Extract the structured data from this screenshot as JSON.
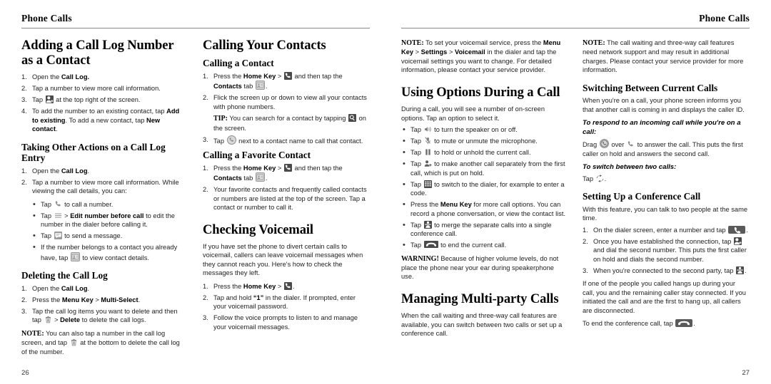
{
  "document": {
    "running_head_left": "Phone Calls",
    "running_head_right": "Phone Calls",
    "folio_left": "26",
    "folio_right": "27"
  },
  "left_page": {
    "column1": {
      "heading_adding": "Adding a Call Log Number as a Contact",
      "adding_steps": [
        "Open the Call Log.",
        "Tap a number to view more call information.",
        "Tap  at the top right of the screen.",
        "To add the number to an existing contact, tap Add to existing. To add a new contact, tap New contact."
      ],
      "heading_other_actions": "Taking Other Actions on a Call Log Entry",
      "other_steps": [
        "Open the Call Log.",
        "Tap a number to view more call information. While viewing the call details, you can:"
      ],
      "other_bullets": [
        "Tap  to call a number.",
        "Tap  > Edit number before call to edit the number in the dialer before calling it.",
        "Tap  to send a message.",
        "If the number belongs to a contact you already have, tap  to view contact details."
      ],
      "heading_deleting": "Deleting the Call Log",
      "deleting_steps": [
        "Open the Call Log.",
        "Press the Menu Key > Multi-Select.",
        "Tap the call log items you want to delete and then tap  > Delete to delete the call logs."
      ],
      "note_label": "NOTE:",
      "note_text": "You can also tap a number in the call log screen, and tap  at the bottom to delete the call log of the number."
    },
    "column2": {
      "heading_calling_contacts": "Calling Your Contacts",
      "heading_calling_contact": "Calling a Contact",
      "contact_steps": [
        "Press the Home Key >  and then tap the Contacts tab .",
        "Flick the screen up or down to view all your contacts with phone numbers.",
        "Tap  next to a contact name to call that contact."
      ],
      "tip_label": "TIP:",
      "tip_text": "You can search for a contact by tapping  on the screen.",
      "heading_favorite": "Calling a Favorite Contact",
      "favorite_steps": [
        "Press the Home Key >  and then tap the Contacts tab .",
        "Your favorite contacts and frequently called contacts or numbers are listed at the top of the screen. Tap a contact or number to call it."
      ],
      "heading_voicemail": "Checking Voicemail",
      "voicemail_intro": "If you have set the phone to divert certain calls to voicemail, callers can leave voicemail messages when they cannot reach you. Here's how to check the messages they left.",
      "voicemail_steps": [
        "Press the Home Key > .",
        "Tap and hold “1” in the dialer. If prompted, enter your voicemail password.",
        "Follow the voice prompts to listen to and manage your voicemail messages."
      ]
    }
  },
  "right_page": {
    "column1": {
      "note_label": "NOTE:",
      "note_text": "To set your voicemail service, press the Menu Key > Settings > Voicemail in the dialer and tap the voicemail settings you want to change. For detailed information, please contact your service provider.",
      "heading_using_options": "Using Options During a Call",
      "using_intro": "During a call, you will see a number of on-screen options. Tap an option to select it.",
      "using_bullets": [
        "Tap  to turn the speaker on or off.",
        "Tap  to mute or unmute the microphone.",
        "Tap  to hold or unhold the current call.",
        "Tap  to make another call separately from the first call, which is put on hold.",
        "Tap  to switch to the dialer, for example to enter a code.",
        "Press the Menu Key for more call options. You can record a phone conversation, or view the contact list.",
        "Tap  to merge the separate calls into a single conference call.",
        "Tap  to end the current call."
      ],
      "warning_label": "WARNING!",
      "warning_text": "Because of higher volume levels, do not place the phone near your ear during speakerphone use.",
      "heading_multiparty": "Managing Multi-party Calls",
      "multiparty_intro": "When the call waiting and three-way call features are available, you can switch between two calls or set up a conference call."
    },
    "column2": {
      "note_label": "NOTE:",
      "note_text": "The call waiting and three-way call features need network support and may result in additional charges. Please contact your service provider for more information.",
      "heading_switching": "Switching Between Current Calls",
      "switching_intro": "When you're on a call, your phone screen informs you that another call is coming in and displays the caller ID.",
      "respond_heading": "To respond to an incoming call while you're on a call:",
      "respond_text_a": "Drag ",
      "respond_text_b": " over ",
      "respond_text_c": " to answer the call. This puts the first caller on hold and answers the second call.",
      "switch_heading": "To switch between two calls:",
      "switch_text": "Tap .",
      "heading_conference": "Setting Up a Conference Call",
      "conference_intro": "With this feature, you can talk to two people at the same time.",
      "conference_steps": [
        "On the dialer screen, enter a number and tap .",
        "Once you have established the connection, tap  and dial the second number. This puts the first caller on hold and dials the second number.",
        "When you're connected to the second party, tap ."
      ],
      "conference_outro": "If one of the people you called hangs up during your call, you and the remaining caller stay connected. If you initiated the call and are the first to hang up, all callers are disconnected.",
      "conference_end": "To end the conference call, tap ."
    }
  },
  "icons": {
    "add_contact": "add-contact-icon",
    "phone_handset": "phone-handset-icon",
    "contacts_tab": "contacts-tab-icon",
    "menu_list": "menu-list-icon",
    "message": "message-icon",
    "contact_card": "contact-card-icon",
    "trash": "trash-icon",
    "search": "search-icon",
    "dialer": "dialer-keypad-icon",
    "speaker": "speaker-icon",
    "mute": "mute-microphone-icon",
    "hold": "pause-hold-icon",
    "add_call": "add-call-icon",
    "merge": "merge-calls-icon",
    "end_call": "end-call-icon",
    "answer_circle": "answer-call-circle-icon",
    "swap": "swap-calls-icon"
  }
}
